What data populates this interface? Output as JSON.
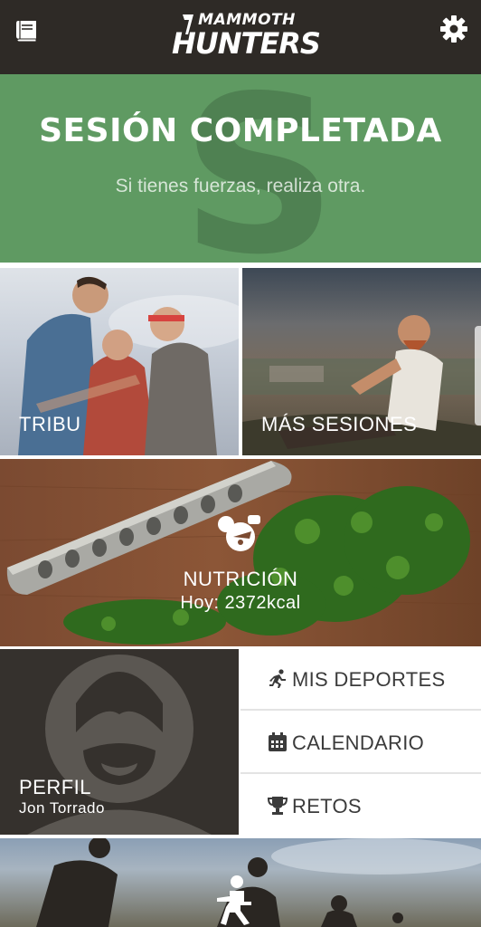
{
  "header": {
    "logo_line1": "MAMMOTH",
    "logo_line2": "HUNTERS",
    "menu_icon": "book-icon",
    "settings_icon": "gear-icon"
  },
  "banner": {
    "title": "SESIÓN COMPLETADA",
    "subtitle": "Si tienes fuerzas, realiza otra.",
    "watermark": "S",
    "color": "#5f9a62"
  },
  "tiles": {
    "tribu": "TRIBU",
    "mas_sesiones": "MÁS SESIONES",
    "nutricion": "NUTRICIÓN",
    "nutricion_detail": "Hoy: 2372kcal",
    "perfil": "PERFIL",
    "perfil_name": "Jon Torrado"
  },
  "menu": [
    {
      "label": "MIS DEPORTES",
      "icon": "running-icon"
    },
    {
      "label": "CALENDARIO",
      "icon": "calendar-icon"
    },
    {
      "label": "RETOS",
      "icon": "trophy-icon"
    }
  ],
  "colors": {
    "topbar": "#2e2a26",
    "accent_green": "#5f9a62"
  }
}
